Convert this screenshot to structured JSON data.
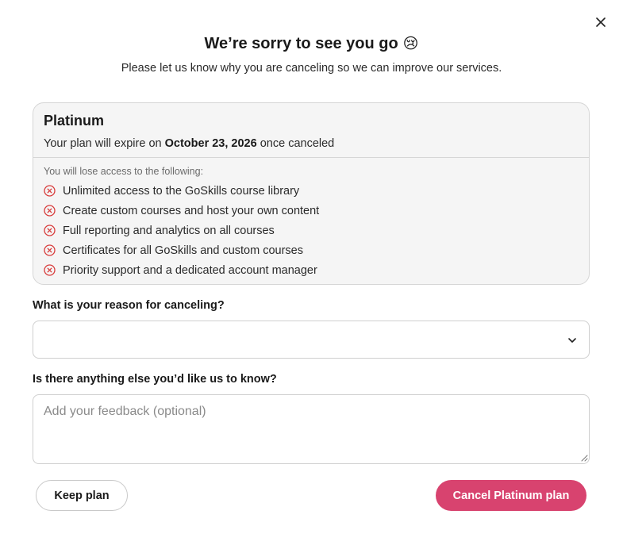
{
  "dialog": {
    "title": "We’re sorry to see you go",
    "title_emoji": "😢",
    "subtitle": "Please let us know why you are canceling so we can improve our services.",
    "close_icon": "close-icon"
  },
  "plan": {
    "name": "Platinum",
    "expiry_prefix": "Your plan will expire on",
    "expiry_date": "October 23, 2026",
    "expiry_suffix": "once canceled",
    "lose_label": "You will lose access to the following:",
    "lose_items": [
      "Unlimited access to the GoSkills course library",
      "Create custom courses and host your own content",
      "Full reporting and analytics on all courses",
      "Certificates for all GoSkills and custom courses",
      "Priority support and a dedicated account manager"
    ]
  },
  "reason": {
    "label": "What is your reason for canceling?",
    "selected_value": ""
  },
  "feedback": {
    "label": "Is there anything else you’d like us to know?",
    "placeholder": "Add your feedback (optional)",
    "value": ""
  },
  "actions": {
    "keep_label": "Keep plan",
    "cancel_label": "Cancel Platinum plan"
  },
  "colors": {
    "accent": "#d8436f",
    "error_icon": "#d83b3b",
    "card_bg": "#f5f5f5"
  }
}
